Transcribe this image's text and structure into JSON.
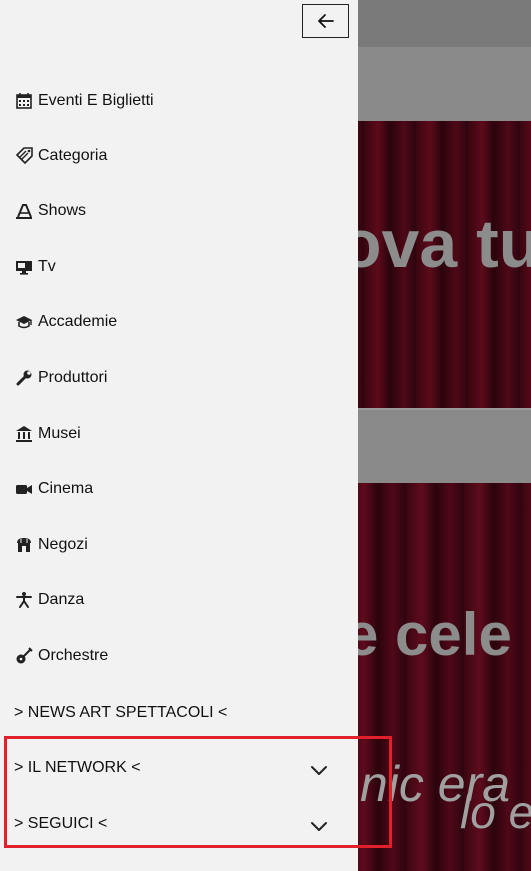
{
  "background": {
    "headline_fragment": "ova tu",
    "subheadline_fragment": "e cele",
    "italic_fragment_1": "nic era",
    "italic_fragment_2": "lo e"
  },
  "drawer": {
    "back_button_icon": "arrow-left-icon",
    "menu_items": [
      {
        "label": "Eventi E Biglietti",
        "icon": "calendar-icon"
      },
      {
        "label": "Categoria",
        "icon": "tag-icon"
      },
      {
        "label": "Shows",
        "icon": "theater-icon"
      },
      {
        "label": "Tv",
        "icon": "tv-icon"
      },
      {
        "label": "Accademie",
        "icon": "graduation-cap-icon"
      },
      {
        "label": "Produttori",
        "icon": "wrench-icon"
      },
      {
        "label": "Musei",
        "icon": "museum-icon"
      },
      {
        "label": "Cinema",
        "icon": "video-camera-icon"
      },
      {
        "label": "Negozi",
        "icon": "store-icon"
      },
      {
        "label": "Danza",
        "icon": "dancer-icon"
      },
      {
        "label": "Orchestre",
        "icon": "guitar-icon"
      }
    ],
    "news_link": "> NEWS ART SPETTACOLI <",
    "network_label": "> IL NETWORK <",
    "follow_label": "> SEGUICI <"
  },
  "colors": {
    "drawer_bg": "#f2f2f2",
    "highlight": "#e0202a",
    "curtain": "#4e0816"
  }
}
